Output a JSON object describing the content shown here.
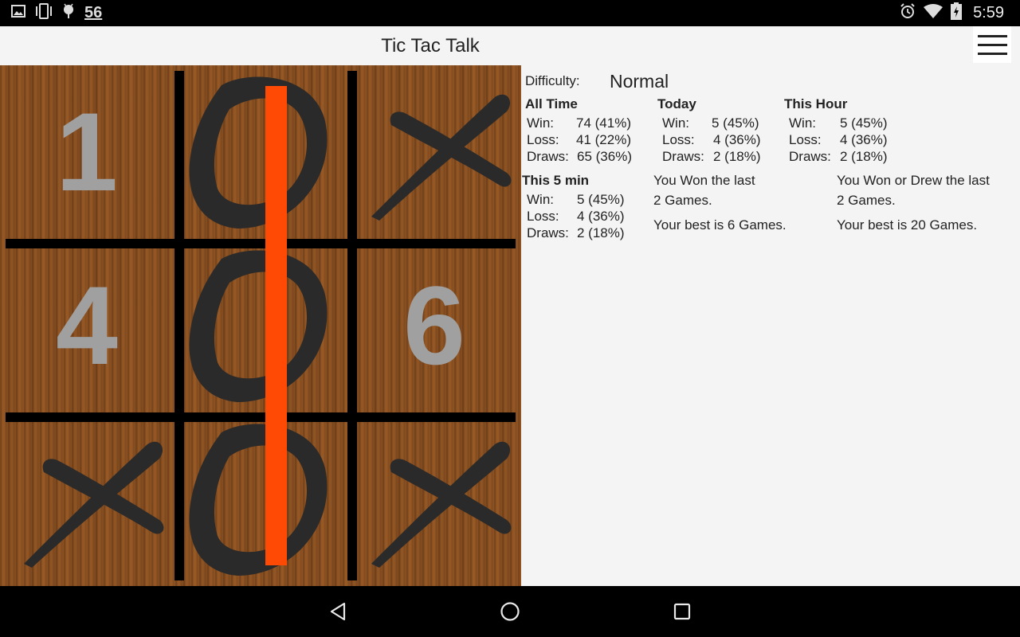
{
  "status_bar": {
    "left_icons": [
      "gallery-icon",
      "vibrate-icon",
      "android-debug-icon"
    ],
    "notification_count": "56",
    "right_icons": [
      "alarm-icon",
      "wifi-icon",
      "battery-charging-icon"
    ],
    "time": "5:59"
  },
  "app_bar": {
    "title": "Tic Tac Talk",
    "menu_icon": "hamburger-menu-icon"
  },
  "board": {
    "cells": [
      {
        "index": 1,
        "mark": "",
        "hint": "1"
      },
      {
        "index": 2,
        "mark": "O",
        "hint": ""
      },
      {
        "index": 3,
        "mark": "X",
        "hint": ""
      },
      {
        "index": 4,
        "mark": "",
        "hint": "4"
      },
      {
        "index": 5,
        "mark": "O",
        "hint": ""
      },
      {
        "index": 6,
        "mark": "",
        "hint": "6"
      },
      {
        "index": 7,
        "mark": "X",
        "hint": ""
      },
      {
        "index": 8,
        "mark": "O",
        "hint": ""
      },
      {
        "index": 9,
        "mark": "X",
        "hint": ""
      }
    ],
    "winning_line": "middle-column",
    "winning_line_color": "#ff4a05"
  },
  "stats": {
    "difficulty_label": "Difficulty:",
    "difficulty_value": "Normal",
    "all_time": {
      "title": "All Time",
      "win_label": "Win:",
      "win": "74 (41%)",
      "loss_label": "Loss:",
      "loss": "41 (22%)",
      "draws_label": "Draws:",
      "draws": "65 (36%)"
    },
    "today": {
      "title": "Today",
      "win_label": "Win:",
      "win": "5 (45%)",
      "loss_label": "Loss:",
      "loss": "4 (36%)",
      "draws_label": "Draws:",
      "draws": "2 (18%)"
    },
    "this_hour": {
      "title": "This Hour",
      "win_label": "Win:",
      "win": "5 (45%)",
      "loss_label": "Loss:",
      "loss": "4 (36%)",
      "draws_label": "Draws:",
      "draws": "2 (18%)"
    },
    "this_5_min": {
      "title": "This 5 min",
      "win_label": "Win:",
      "win": "5 (45%)",
      "loss_label": "Loss:",
      "loss": "4 (36%)",
      "draws_label": "Draws:",
      "draws": "2 (18%)"
    },
    "streak_won": {
      "line1": "You Won the last",
      "line2": "2 Games.",
      "best": "Your best is 6 Games."
    },
    "streak_won_or_drew": {
      "line1": "You Won or Drew the last",
      "line2": "2 Games.",
      "best": "Your best is 20 Games."
    }
  },
  "nav_bar": {
    "buttons": [
      "back-icon",
      "home-icon",
      "recents-icon"
    ]
  }
}
